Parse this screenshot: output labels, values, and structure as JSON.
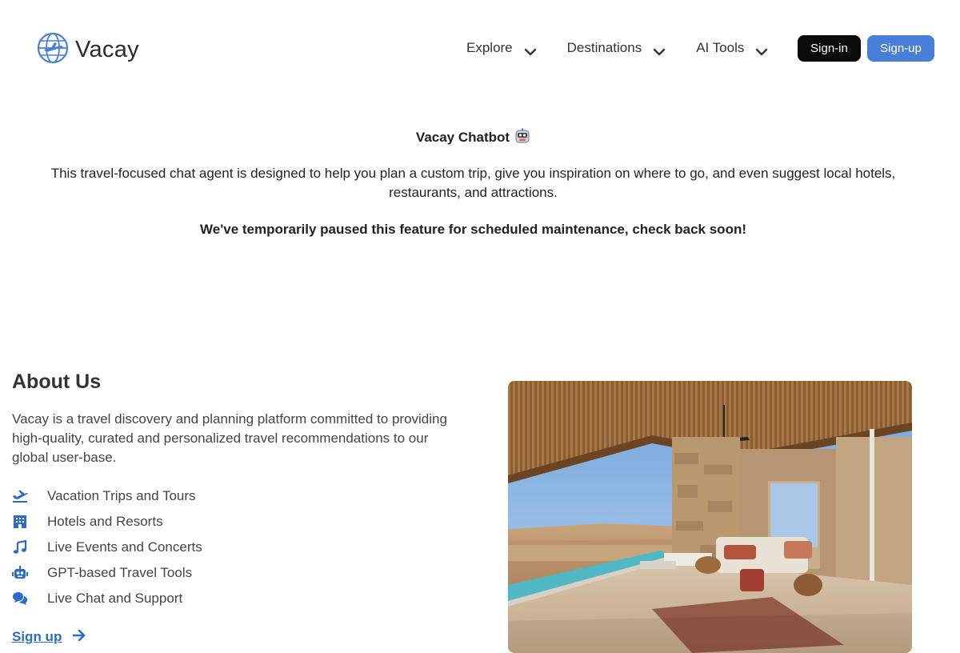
{
  "brand": {
    "name": "Vacay"
  },
  "nav": {
    "items": [
      {
        "label": "Explore"
      },
      {
        "label": "Destinations"
      },
      {
        "label": "AI Tools"
      }
    ]
  },
  "auth": {
    "signin_label": "Sign-in",
    "signup_label": "Sign-up"
  },
  "chatbot": {
    "title": "Vacay Chatbot",
    "description": "This travel-focused chat agent is designed to help you plan a custom trip, give you inspiration on where to go, and even suggest local hotels, restaurants, and attractions.",
    "notice": "We've temporarily paused this feature for scheduled maintenance, check back soon!"
  },
  "about": {
    "title": "About Us",
    "description": "Vacay is a travel discovery and planning platform committed to providing high-quality, curated and personalized travel recommendations to our global user-base.",
    "features": [
      {
        "label": "Vacation Trips and Tours",
        "icon": "plane-departure-icon"
      },
      {
        "label": "Hotels and Resorts",
        "icon": "hotel-building-icon"
      },
      {
        "label": "Live Events and Concerts",
        "icon": "music-note-icon"
      },
      {
        "label": "GPT-based Travel Tools",
        "icon": "robot-icon"
      },
      {
        "label": "Live Chat and Support",
        "icon": "chat-bubbles-icon"
      }
    ],
    "signup_link": "Sign up"
  },
  "colors": {
    "accent": "#4a7fd8",
    "link": "#2b6cc4",
    "dark_button": "#0a0a0a"
  }
}
